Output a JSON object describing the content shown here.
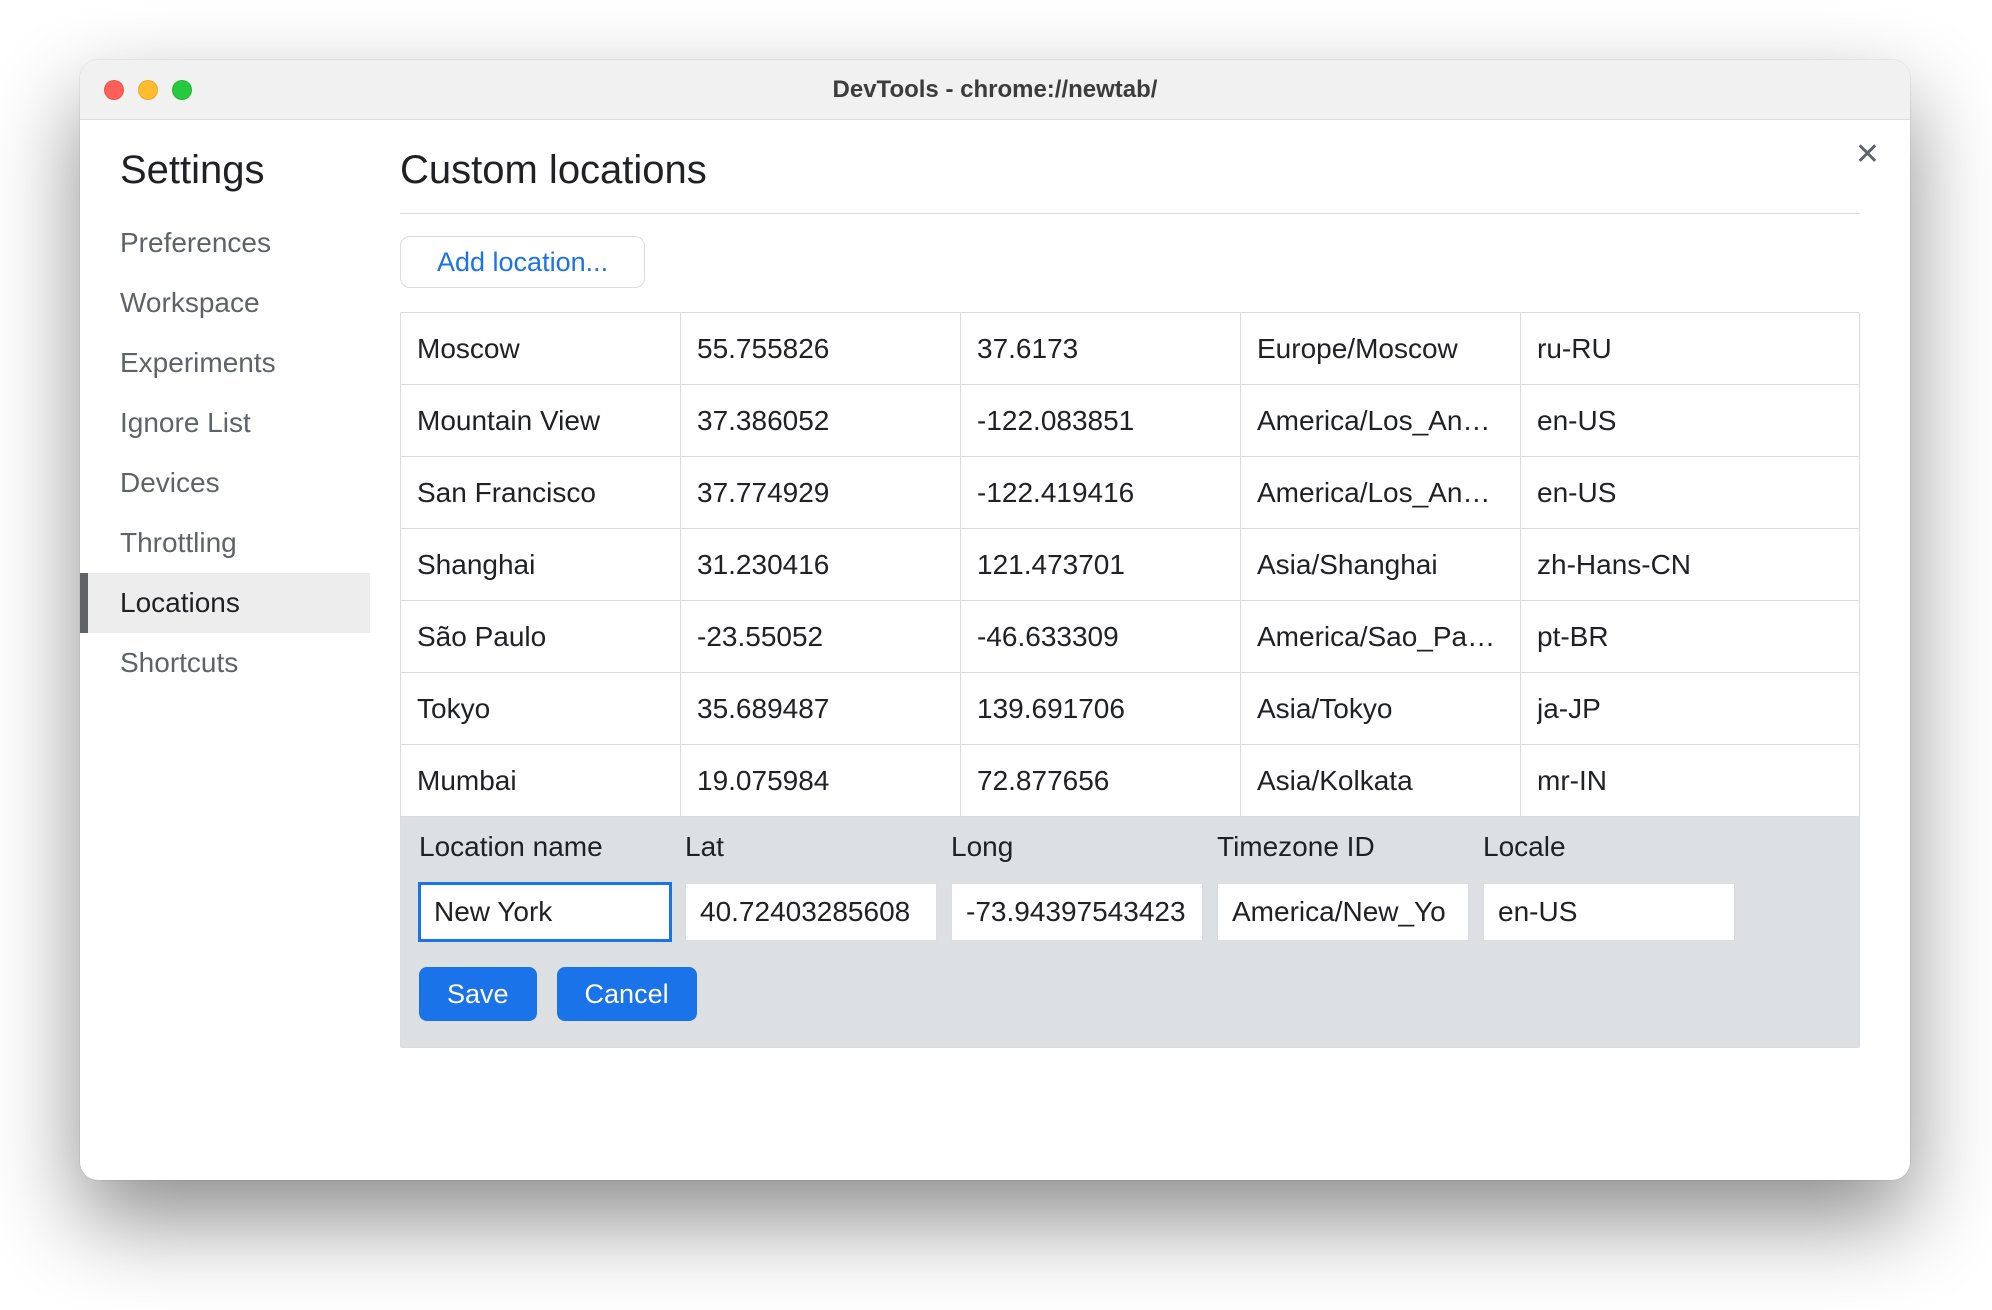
{
  "window": {
    "title": "DevTools - chrome://newtab/"
  },
  "sidebar": {
    "title": "Settings",
    "items": [
      {
        "label": "Preferences",
        "selected": false
      },
      {
        "label": "Workspace",
        "selected": false
      },
      {
        "label": "Experiments",
        "selected": false
      },
      {
        "label": "Ignore List",
        "selected": false
      },
      {
        "label": "Devices",
        "selected": false
      },
      {
        "label": "Throttling",
        "selected": false
      },
      {
        "label": "Locations",
        "selected": true
      },
      {
        "label": "Shortcuts",
        "selected": false
      }
    ]
  },
  "main": {
    "title": "Custom locations",
    "add_button": "Add location...",
    "close_label": "✕",
    "locations": [
      {
        "name": "Moscow",
        "lat": "55.755826",
        "long": "37.6173",
        "tz": "Europe/Moscow",
        "locale": "ru-RU"
      },
      {
        "name": "Mountain View",
        "lat": "37.386052",
        "long": "-122.083851",
        "tz": "America/Los_An…",
        "locale": "en-US"
      },
      {
        "name": "San Francisco",
        "lat": "37.774929",
        "long": "-122.419416",
        "tz": "America/Los_An…",
        "locale": "en-US"
      },
      {
        "name": "Shanghai",
        "lat": "31.230416",
        "long": "121.473701",
        "tz": "Asia/Shanghai",
        "locale": "zh-Hans-CN"
      },
      {
        "name": "São Paulo",
        "lat": "-23.55052",
        "long": "-46.633309",
        "tz": "America/Sao_Pa…",
        "locale": "pt-BR"
      },
      {
        "name": "Tokyo",
        "lat": "35.689487",
        "long": "139.691706",
        "tz": "Asia/Tokyo",
        "locale": "ja-JP"
      },
      {
        "name": "Mumbai",
        "lat": "19.075984",
        "long": "72.877656",
        "tz": "Asia/Kolkata",
        "locale": "mr-IN"
      }
    ],
    "edit": {
      "headers": {
        "name": "Location name",
        "lat": "Lat",
        "long": "Long",
        "tz": "Timezone ID",
        "locale": "Locale"
      },
      "values": {
        "name": "New York",
        "lat": "40.72403285608",
        "long": "-73.94397543423",
        "tz": "America/New_Yo",
        "locale": "en-US"
      },
      "save": "Save",
      "cancel": "Cancel"
    }
  }
}
